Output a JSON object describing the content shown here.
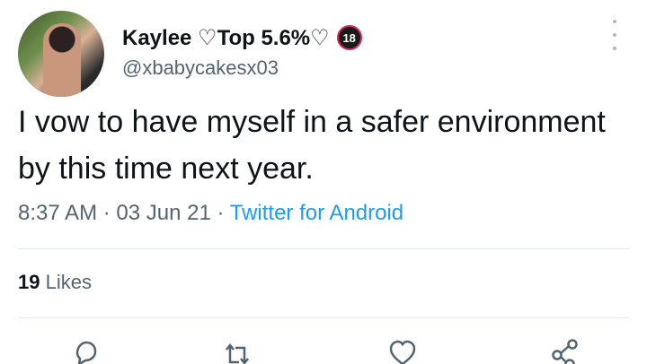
{
  "tweet": {
    "author": {
      "display_name": "Kaylee ♡Top 5.6%♡",
      "badge": "18",
      "handle": "@xbabycakesx03"
    },
    "text": "I vow to have myself in a safer environment by this time next year.",
    "time": "8:37 AM",
    "date": "03 Jun 21",
    "separator": "·",
    "source": "Twitter for Android",
    "likes": {
      "count": "19",
      "label": "Likes"
    },
    "icons": [
      "more-vertical-icon",
      "reply-icon",
      "retweet-icon",
      "like-icon",
      "share-icon"
    ]
  },
  "colors": {
    "text": "#0f1419",
    "muted": "#536471",
    "link": "#1d9bf0",
    "divider": "#e1e8ed"
  }
}
